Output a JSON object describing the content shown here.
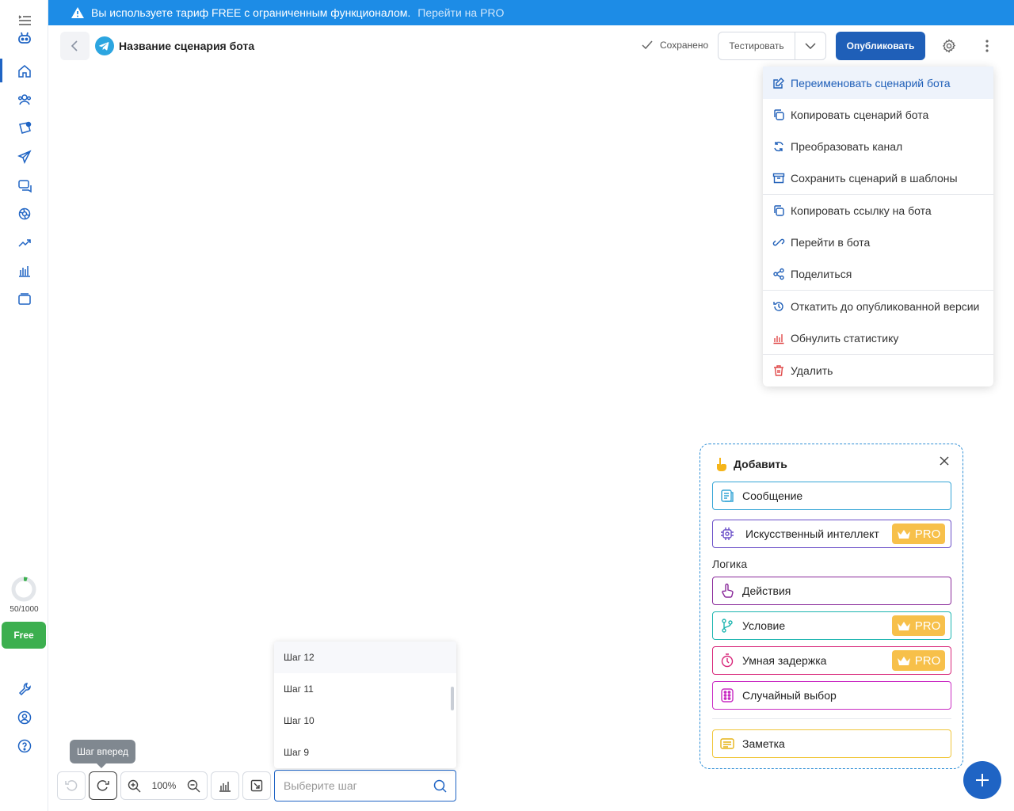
{
  "banner": {
    "text": "Вы используете тариф FREE с ограниченным функционалом.",
    "link": "Перейти на PRO"
  },
  "header": {
    "bot_title": "Название сценария бота",
    "saved_label": "Сохранено",
    "test_label": "Тестировать",
    "publish_label": "Опубликовать"
  },
  "sidebar": {
    "usage": "50/1000",
    "usage_fraction": 0.05,
    "plan": "Free"
  },
  "menu": {
    "items": [
      {
        "label": "Переименовать сценарий бота",
        "icon": "edit-icon"
      },
      {
        "label": "Копировать сценарий бота",
        "icon": "copy-icon"
      },
      {
        "label": "Преобразовать канал",
        "icon": "refresh-icon"
      },
      {
        "label": "Сохранить сценарий в шаблоны",
        "icon": "archive-icon"
      },
      {
        "label": "Копировать ссылку на бота",
        "icon": "copy-icon"
      },
      {
        "label": "Перейти в бота",
        "icon": "link-icon"
      },
      {
        "label": "Поделиться",
        "icon": "share-icon"
      },
      {
        "label": "Откатить до опубликованной версии",
        "icon": "history-icon"
      },
      {
        "label": "Обнулить статистику",
        "icon": "chart-icon"
      },
      {
        "label": "Удалить",
        "icon": "trash-icon"
      }
    ]
  },
  "add_panel": {
    "title": "Добавить",
    "message": "Сообщение",
    "ai": "Искусственный интеллект",
    "logic_label": "Логика",
    "actions": "Действия",
    "condition": "Условие",
    "smart_delay": "Умная задержка",
    "random": "Случайный выбор",
    "note": "Заметка",
    "pro_badge": "PRO"
  },
  "toolbar": {
    "zoom": "100%",
    "tooltip": "Шаг вперед",
    "search_placeholder": "Выберите шаг",
    "steps": [
      "Шаг 12",
      "Шаг 11",
      "Шаг 10",
      "Шаг 9"
    ]
  },
  "colors": {
    "primary": "#1f64c4",
    "banner": "#1d8ce6",
    "free": "#3caf4f",
    "pro": "#f7c04a"
  }
}
